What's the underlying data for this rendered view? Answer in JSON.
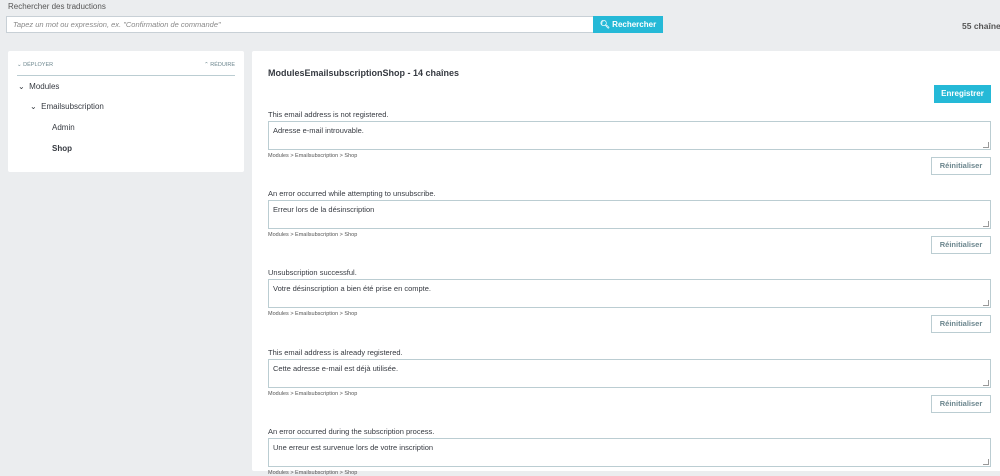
{
  "search": {
    "label": "Rechercher des traductions",
    "placeholder": "Tapez un mot ou expression, ex. \"Confirmation de commande\"",
    "button": "Rechercher",
    "count": "55 chaînes"
  },
  "tree": {
    "expand": "DÉPLOYER",
    "collapse": "RÉDUIRE",
    "nodes": [
      "Modules",
      "Emailsubscription",
      "Admin",
      "Shop"
    ]
  },
  "main": {
    "title": "ModulesEmailsubscriptionShop - 14 chaînes",
    "save": "Enregistrer",
    "reset": "Réinitialiser",
    "entries": [
      {
        "source": "This email address is not registered.",
        "translation": "Adresse e-mail introuvable.",
        "path": "Modules > Emailsubscription > Shop"
      },
      {
        "source": "An error occurred while attempting to unsubscribe.",
        "translation": "Erreur lors de la désinscription",
        "path": "Modules > Emailsubscription > Shop"
      },
      {
        "source": "Unsubscription successful.",
        "translation": "Votre désinscription a bien été prise en compte.",
        "path": "Modules > Emailsubscription > Shop"
      },
      {
        "source": "This email address is already registered.",
        "translation": "Cette adresse e-mail est déjà utilisée.",
        "path": "Modules > Emailsubscription > Shop"
      },
      {
        "source": "An error occurred during the subscription process.",
        "translation": "Une erreur est survenue lors de votre inscription",
        "path": "Modules > Emailsubscription > Shop"
      }
    ]
  }
}
